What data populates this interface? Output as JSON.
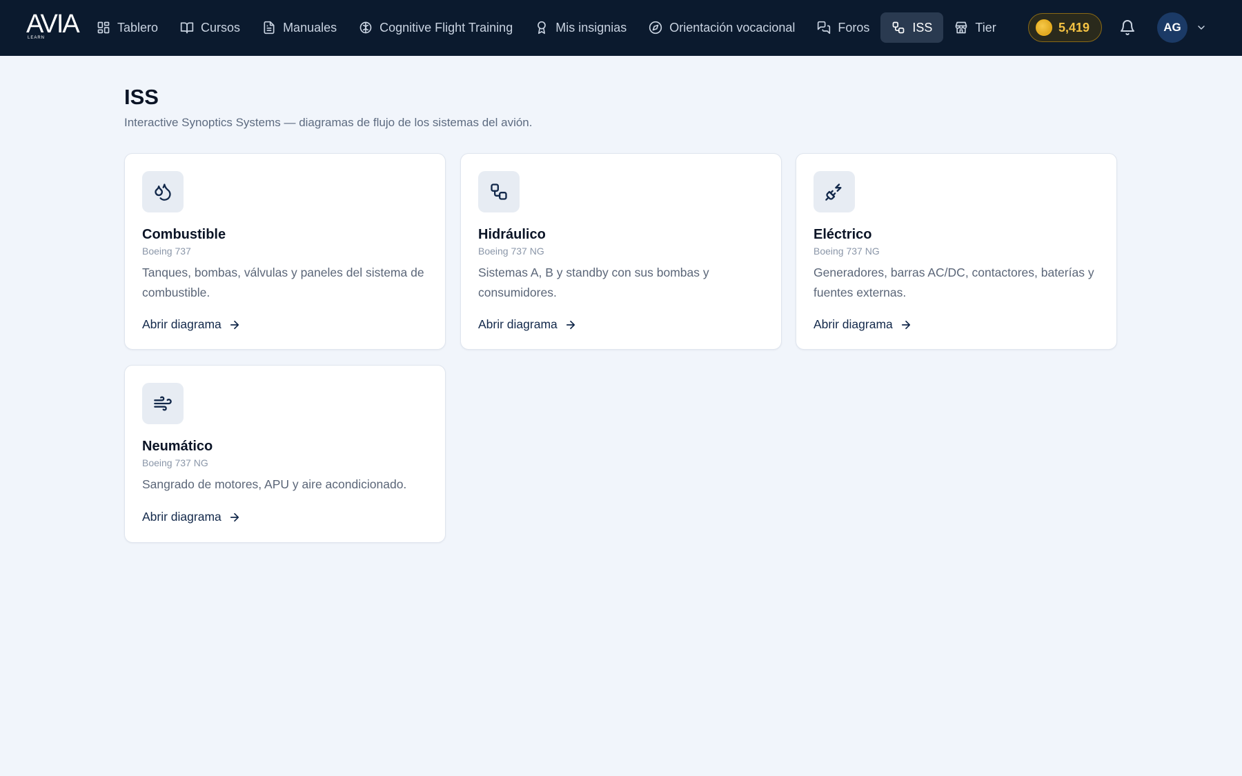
{
  "app": {
    "logo_text": "AVIA",
    "logo_sub": "LEARN"
  },
  "nav": {
    "items": [
      {
        "label": "Tablero",
        "icon": "dashboard-icon"
      },
      {
        "label": "Cursos",
        "icon": "book-icon"
      },
      {
        "label": "Manuales",
        "icon": "document-icon"
      },
      {
        "label": "Cognitive Flight Training",
        "icon": "brain-icon"
      },
      {
        "label": "Mis insignias",
        "icon": "award-icon"
      },
      {
        "label": "Orientación vocacional",
        "icon": "compass-icon"
      },
      {
        "label": "Foros",
        "icon": "chat-icon"
      },
      {
        "label": "ISS",
        "icon": "workflow-icon",
        "active": true
      },
      {
        "label": "Tier",
        "icon": "store-icon"
      }
    ],
    "coins": "5,419",
    "avatar_initials": "AG"
  },
  "page": {
    "title": "ISS",
    "subtitle": "Interactive Synoptics Systems — diagramas de flujo de los sistemas del avión."
  },
  "cards": [
    {
      "title": "Combustible",
      "model": "Boeing 737",
      "description": "Tanques, bombas, válvulas y paneles del sistema de combustible.",
      "link": "Abrir diagrama",
      "icon": "droplets-icon"
    },
    {
      "title": "Hidráulico",
      "model": "Boeing 737 NG",
      "description": "Sistemas A, B y standby con sus bombas y consumidores.",
      "link": "Abrir diagrama",
      "icon": "workflow-icon"
    },
    {
      "title": "Eléctrico",
      "model": "Boeing 737 NG",
      "description": "Generadores, barras AC/DC, contactores, baterías y fuentes externas.",
      "link": "Abrir diagrama",
      "icon": "plug-zap-icon"
    },
    {
      "title": "Neumático",
      "model": "Boeing 737 NG",
      "description": "Sangrado de motores, APU y aire acondicionado.",
      "link": "Abrir diagrama",
      "icon": "wind-icon"
    }
  ],
  "colors": {
    "topbar": "#0b1a2e",
    "background": "#f1f5fb",
    "accent_gold": "#f5c343",
    "link": "#12284a"
  }
}
